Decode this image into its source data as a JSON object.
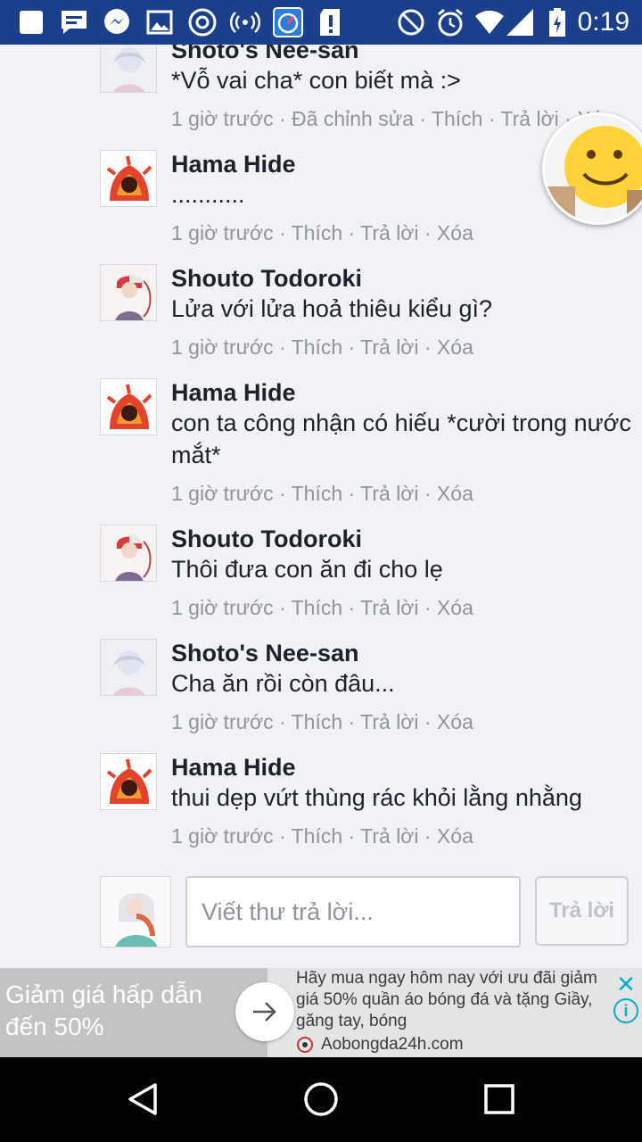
{
  "status_bar": {
    "time": "0:19",
    "icons": [
      "notification-square-icon",
      "messages-icon",
      "messenger-icon",
      "gallery-icon",
      "chrome-icon",
      "hotspot-icon",
      "speedometer-icon",
      "sdcard-alert-icon",
      "do-not-disturb-icon",
      "alarm-icon",
      "wifi-icon",
      "signal-icon",
      "battery-icon"
    ]
  },
  "comments": [
    {
      "author": "Shoto's Nee-san",
      "text": "*Vỗ vai cha* con biết mà :>",
      "meta": "1 giờ trước · Đã chỉnh sửa · Thích · Trả lời · Xóa",
      "avatar": "nee-san"
    },
    {
      "author": "Hama Hide",
      "text": "...........",
      "meta": "1 giờ trước · Thích · Trả lời · Xóa",
      "avatar": "hama"
    },
    {
      "author": "Shouto Todoroki",
      "text": "Lửa với lửa hoả thiêu kiểu gì?",
      "meta": "1 giờ trước · Thích · Trả lời · Xóa",
      "avatar": "todoroki"
    },
    {
      "author": "Hama Hide",
      "text": "con ta công nhận có hiếu *cười trong nước mắt*",
      "meta": "1 giờ trước · Thích · Trả lời · Xóa",
      "avatar": "hama"
    },
    {
      "author": "Shouto Todoroki",
      "text": "Thôi đưa con ăn đi cho lẹ",
      "meta": "1 giờ trước · Thích · Trả lời · Xóa",
      "avatar": "todoroki"
    },
    {
      "author": "Shoto's Nee-san",
      "text": "Cha ăn rồi còn đâu...",
      "meta": "1 giờ trước · Thích · Trả lời · Xóa",
      "avatar": "nee-san"
    },
    {
      "author": "Hama Hide",
      "text": "thui dẹp vứt thùng rác khỏi lằng nhằng",
      "meta": "1 giờ trước · Thích · Trả lời · Xóa",
      "avatar": "hama"
    }
  ],
  "reply": {
    "placeholder": "Viết thư trả lời...",
    "button": "Trả lời"
  },
  "ad": {
    "headline": "Giảm giá hấp dẫn đến 50%",
    "description": "Hãy mua ngay hôm nay với ưu đãi giảm giá 50% quần áo bóng đá và tặng Giầy, găng tay, bóng",
    "site": "Aobongda24h.com"
  },
  "colors": {
    "status_bar": "#1c3f8c",
    "background": "#f0f2f5",
    "meta_text": "#90949c",
    "ad_accent": "#00aecd"
  }
}
